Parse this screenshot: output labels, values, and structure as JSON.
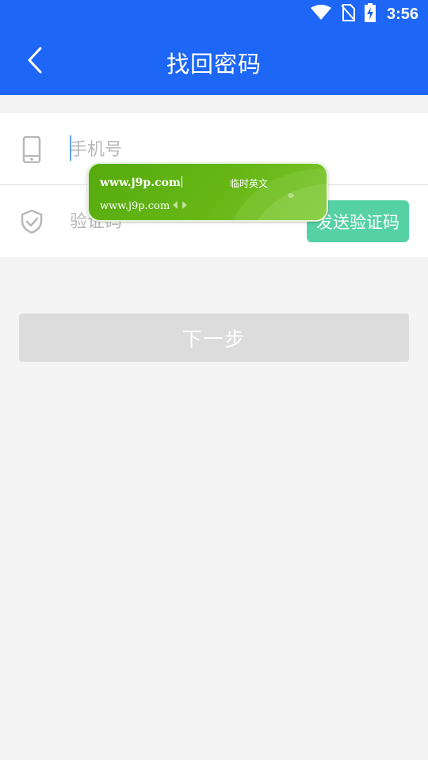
{
  "status_bar": {
    "time": "3:56",
    "icons": [
      "wifi-icon",
      "no-sim-icon",
      "battery-charging-icon"
    ]
  },
  "header": {
    "title": "找回密码",
    "back_icon": "chevron-left-icon",
    "color": "#1e66f5"
  },
  "form": {
    "phone": {
      "placeholder": "手机号",
      "value": "",
      "icon": "phone-icon"
    },
    "code": {
      "placeholder": "验证码",
      "value": "",
      "icon": "shield-check-icon"
    },
    "send_code_label": "发送验证码",
    "send_code_color": "#56d1a5"
  },
  "ime_popup": {
    "composing": "www.j9p.com",
    "mode": "临时英文",
    "candidate": "www.j9p.com",
    "color": "#66b714"
  },
  "next_button": {
    "label": "下一步",
    "color": "#dcdcdc"
  }
}
